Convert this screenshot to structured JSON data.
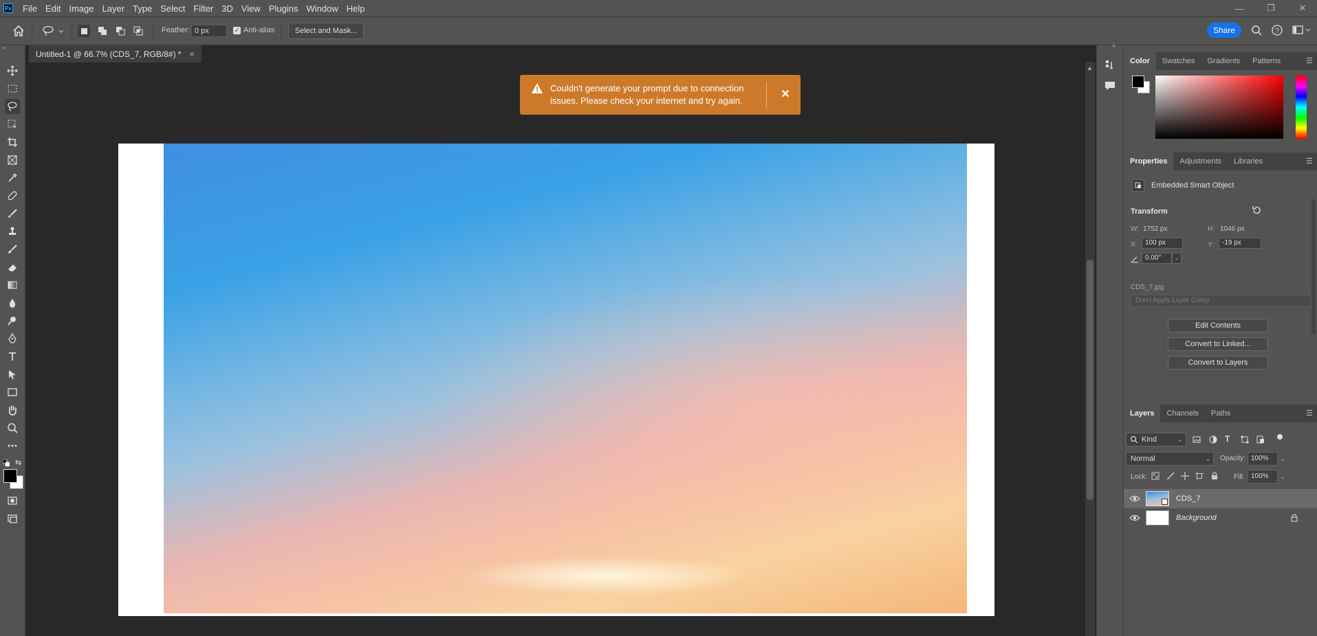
{
  "app": {
    "logo": "Ps"
  },
  "menu": [
    "File",
    "Edit",
    "Image",
    "Layer",
    "Type",
    "Select",
    "Filter",
    "3D",
    "View",
    "Plugins",
    "Window",
    "Help"
  ],
  "window_controls": {
    "minimize": "—",
    "restore": "❐",
    "close": "✕"
  },
  "options_bar": {
    "feather_label": "Feather:",
    "feather_value": "0 px",
    "antialias_label": "Anti-alias",
    "antialias_checked": true,
    "select_mask_label": "Select and Mask...",
    "share_label": "Share"
  },
  "document": {
    "tab_title": "Untitled-1 @ 66.7% (CDS_7, RGB/8#) *",
    "tab_close": "×"
  },
  "toast": {
    "message": "Couldn't generate your prompt due to connection issues. Please check your internet and try again.",
    "close": "✕",
    "color": "#cc7a2a"
  },
  "color_panel": {
    "tabs": [
      "Color",
      "Swatches",
      "Gradients",
      "Patterns"
    ],
    "foreground": "#000000",
    "background": "#ffffff",
    "hue": "#ff0000"
  },
  "properties_panel": {
    "tabs": [
      "Properties",
      "Adjustments",
      "Libraries"
    ],
    "object_type": "Embedded Smart Object",
    "transform_label": "Transform",
    "w_label": "W:",
    "w_value": "1752 px",
    "h_label": "H:",
    "h_value": "1046 px",
    "x_label": "X:",
    "x_value": "100 px",
    "y_label": "Y:",
    "y_value": "-19 px",
    "angle_value": "0.00°",
    "filename": "CDS_7.jpg",
    "layer_comp": "Don't Apply Layer Comp",
    "buttons": [
      "Edit Contents",
      "Convert to Linked...",
      "Convert to Layers"
    ]
  },
  "layers_panel": {
    "tabs": [
      "Layers",
      "Channels",
      "Paths"
    ],
    "filter_kind": "Kind",
    "blend_mode": "Normal",
    "opacity_label": "Opacity:",
    "opacity_value": "100%",
    "lock_label": "Lock:",
    "fill_label": "Fill:",
    "fill_value": "100%",
    "layers": [
      {
        "name": "CDS_7",
        "selected": true
      },
      {
        "name": "Background",
        "selected": false
      }
    ]
  }
}
